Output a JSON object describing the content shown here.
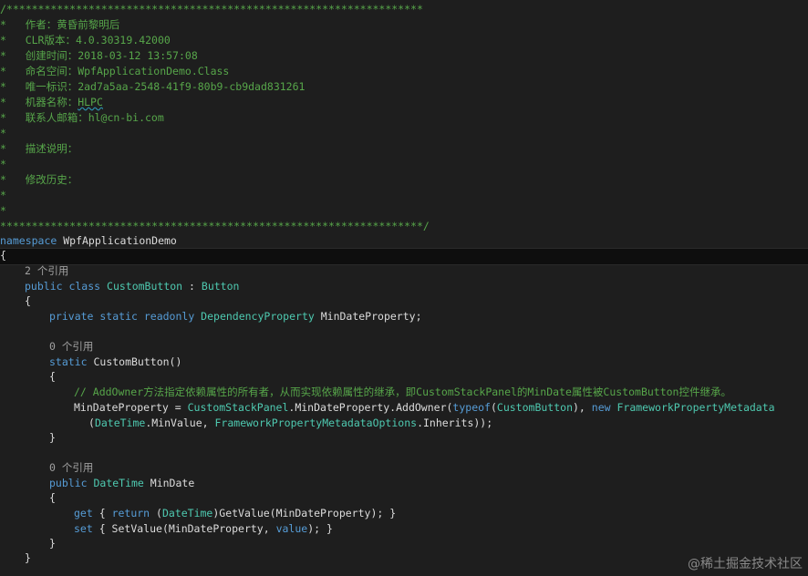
{
  "header": {
    "top_border": "/******************************************************************",
    "author": "*   作者：黄昏前黎明后",
    "clr": "*   CLR版本：4.0.30319.42000",
    "created": "*   创建时间：2018-03-12 13:57:08",
    "namespace": "*   命名空间：WpfApplicationDemo.Class",
    "guid": "*   唯一标识：2ad7a5aa-2548-41f9-80b9-cb9dad831261",
    "machine_prefix": "*   机器名称：",
    "machine_name": "HLPC",
    "email": "*   联系人邮箱：hl@cn-bi.com",
    "star": "*",
    "description": "*   描述说明：",
    "history": "*   修改历史：",
    "bottom_border": "*******************************************************************/"
  },
  "code": {
    "ns_kw": "namespace",
    "ns_name": " WpfApplicationDemo",
    "open_brace": "{",
    "close_brace": "}",
    "refs2": "2 个引用",
    "class_kw": "public class ",
    "class_name": "CustomButton",
    "class_colon": " : ",
    "class_base": "Button",
    "field_kw": "private static readonly ",
    "field_type": "DependencyProperty",
    "field_name": " MinDateProperty;",
    "refs0": "0 个引用",
    "ctor_kw": "static ",
    "ctor_name": "CustomButton()",
    "comment": "// AddOwner方法指定依赖属性的所有者，从而实现依赖属性的继承，即CustomStackPanel的MinDate属性被CustomButton控件继承。",
    "assign_a": "MinDateProperty = ",
    "assign_type": "CustomStackPanel",
    "assign_b": ".MinDateProperty.AddOwner(",
    "typeof_kw": "typeof",
    "paren_open": "(",
    "assign_type2": "CustomButton",
    "paren_comma": "), ",
    "new_kw": "new ",
    "meta_type": "FrameworkPropertyMetadata",
    "arg_type1": "DateTime",
    "arg_b": ".MinValue, ",
    "arg_type2": "FrameworkPropertyMetadataOptions",
    "arg_c": ".Inherits));",
    "prop_kw": "public ",
    "prop_type": "DateTime",
    "prop_name": " MinDate",
    "get_kw": "get",
    "get_a": " { ",
    "return_kw": "return",
    "get_b": " (",
    "get_type": "DateTime",
    "get_c": ")GetValue(MinDateProperty); }",
    "set_kw": "set",
    "set_a": " { SetValue(MinDateProperty, ",
    "value_kw": "value",
    "set_b": "); }"
  },
  "watermark": "@稀土掘金技术社区",
  "colors": {
    "background": "#1e1e1e",
    "comment": "#57a64a",
    "keyword": "#569cd6",
    "type": "#4ec9b0",
    "text": "#dcdcdc",
    "codelens": "#a0a0a0"
  }
}
